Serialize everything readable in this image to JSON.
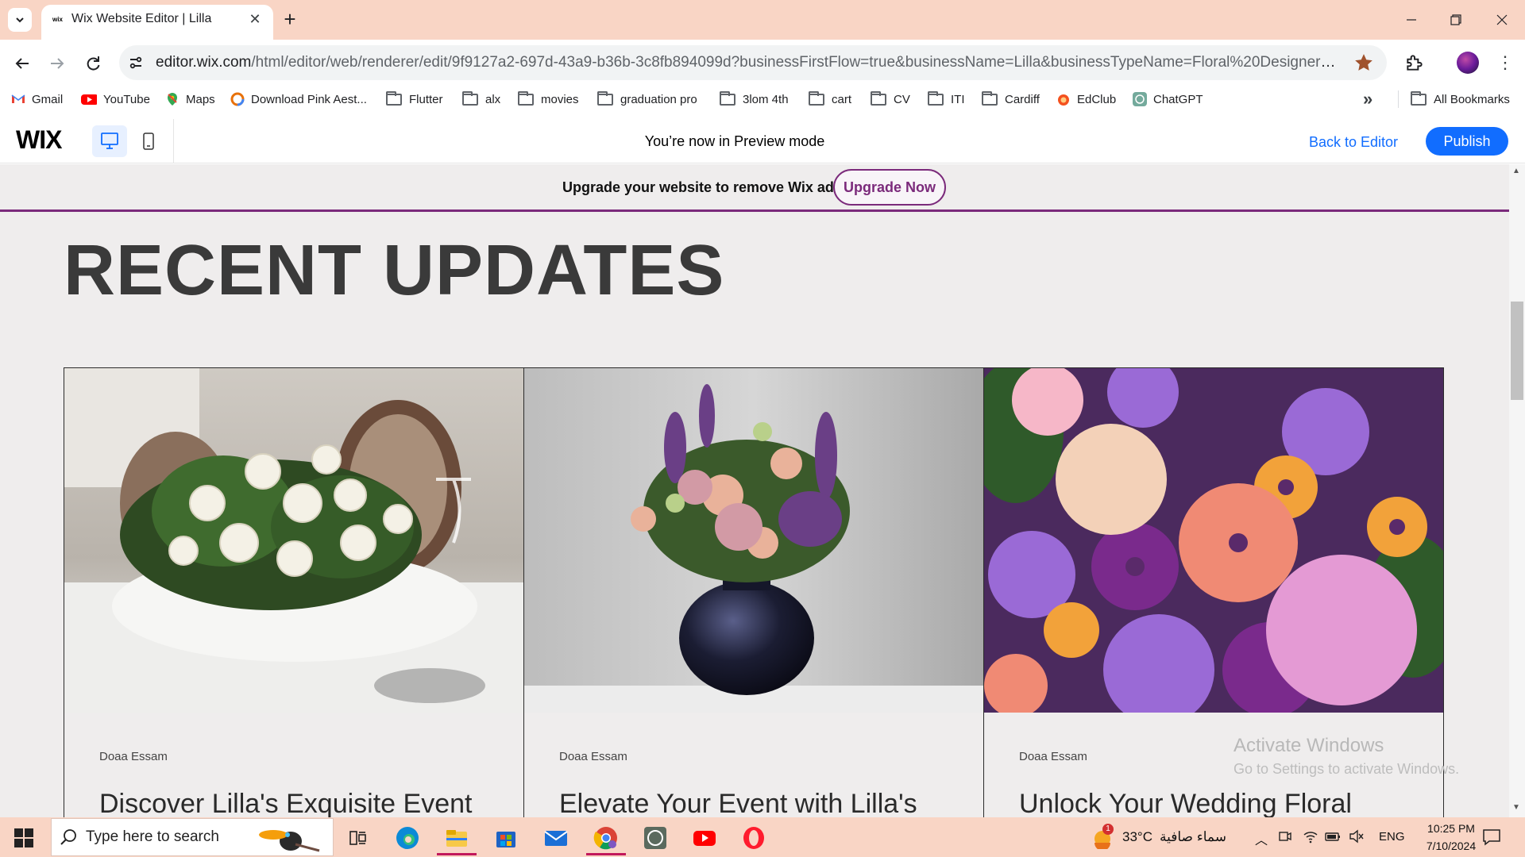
{
  "browser": {
    "tab_title": "Wix Website Editor | Lilla",
    "tab_favicon_text": "wix",
    "url_host": "editor.wix.com",
    "url_rest": "/html/editor/web/renderer/edit/9f9127a2-697d-43a9-b36b-3c8fb894099d?businessFirstFlow=true&businessName=Lilla&businessTypeName=Floral%20Designer%20Portfolio&in...",
    "bookmarks": [
      {
        "label": "Gmail",
        "icon": "gmail-icon"
      },
      {
        "label": "YouTube",
        "icon": "youtube-icon"
      },
      {
        "label": "Maps",
        "icon": "maps-icon"
      },
      {
        "label": "Download Pink Aest...",
        "icon": "download-site-icon"
      },
      {
        "label": "Flutter",
        "icon": "folder-icon"
      },
      {
        "label": "alx",
        "icon": "folder-icon"
      },
      {
        "label": "movies",
        "icon": "folder-icon"
      },
      {
        "label": "graduation pro",
        "icon": "folder-icon"
      },
      {
        "label": "3lom 4th",
        "icon": "folder-icon"
      },
      {
        "label": "cart",
        "icon": "folder-icon"
      },
      {
        "label": "CV",
        "icon": "folder-icon"
      },
      {
        "label": "ITI",
        "icon": "folder-icon"
      },
      {
        "label": "Cardiff",
        "icon": "folder-icon"
      },
      {
        "label": "EdClub",
        "icon": "edclub-icon"
      },
      {
        "label": "ChatGPT",
        "icon": "chatgpt-icon"
      }
    ],
    "all_bookmarks": "All Bookmarks"
  },
  "wix_bar": {
    "logo": "WIX",
    "preview_message": "You’re now in Preview mode",
    "back_to_editor": "Back to Editor",
    "publish": "Publish"
  },
  "site": {
    "upgrade_text": "Upgrade your website to remove Wix ads",
    "upgrade_button": "Upgrade Now",
    "section_title": "RECENT UPDATES",
    "posts": [
      {
        "author": "Doaa Essam",
        "title": "Discover Lilla's Exquisite Event",
        "image": "white-roses-table-image"
      },
      {
        "author": "Doaa Essam",
        "title": "Elevate Your Event with Lilla's",
        "image": "vase-bouquet-image"
      },
      {
        "author": "Doaa Essam",
        "title": "Unlock Your Wedding Floral",
        "image": "colorful-flowers-image"
      }
    ],
    "watermark_title": "Activate Windows",
    "watermark_sub": "Go to Settings to activate Windows."
  },
  "taskbar": {
    "search_placeholder": "Type here to search",
    "weather_temp": "33°C",
    "weather_desc": "سماء صافية",
    "weather_badge": "1",
    "language": "ENG",
    "time": "10:25 PM",
    "date": "7/10/2024"
  },
  "colors": {
    "chrome_bg": "#f9d5c5",
    "wix_blue": "#116dff",
    "upgrade_purple": "#7b2a7b",
    "page_bg": "#efeded"
  }
}
